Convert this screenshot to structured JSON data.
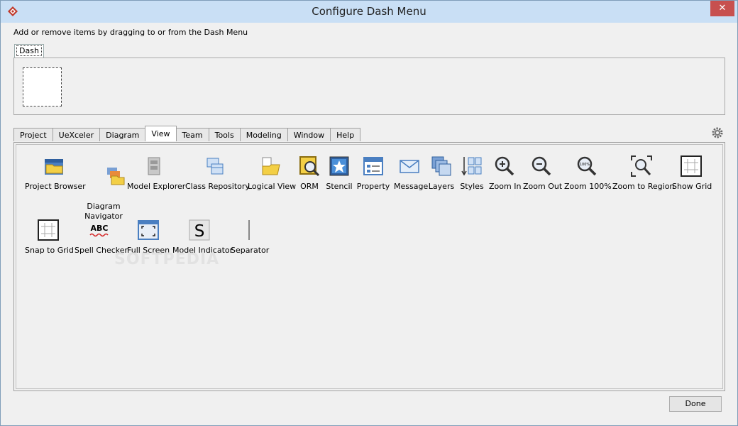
{
  "window": {
    "title": "Configure Dash Menu"
  },
  "instruction": "Add or remove items by dragging to or from the Dash Menu",
  "dash": {
    "tab_label": "Dash"
  },
  "tabs": [
    {
      "label": "Project"
    },
    {
      "label": "UeXceler"
    },
    {
      "label": "Diagram"
    },
    {
      "label": "View"
    },
    {
      "label": "Team"
    },
    {
      "label": "Tools"
    },
    {
      "label": "Modeling"
    },
    {
      "label": "Window"
    },
    {
      "label": "Help"
    }
  ],
  "active_tab": "View",
  "items": [
    {
      "label": "Project Browser",
      "icon": "project-browser-icon"
    },
    {
      "label": "Diagram\nNavigator",
      "icon": "diagram-navigator-icon"
    },
    {
      "label": "Model Explorer",
      "icon": "model-explorer-icon"
    },
    {
      "label": "Class Repository",
      "icon": "class-repository-icon"
    },
    {
      "label": "Logical View",
      "icon": "logical-view-icon"
    },
    {
      "label": "ORM",
      "icon": "orm-icon"
    },
    {
      "label": "Stencil",
      "icon": "stencil-icon"
    },
    {
      "label": "Property",
      "icon": "property-icon"
    },
    {
      "label": "Message",
      "icon": "message-icon"
    },
    {
      "label": "Layers",
      "icon": "layers-icon"
    },
    {
      "label": "Styles",
      "icon": "styles-icon"
    },
    {
      "label": "Zoom In",
      "icon": "zoom-in-icon"
    },
    {
      "label": "Zoom Out",
      "icon": "zoom-out-icon"
    },
    {
      "label": "Zoom 100%",
      "icon": "zoom-100-icon"
    },
    {
      "label": "Zoom to Region",
      "icon": "zoom-region-icon"
    },
    {
      "label": "Show Grid",
      "icon": "show-grid-icon"
    },
    {
      "label": "Snap to Grid",
      "icon": "snap-grid-icon"
    },
    {
      "label": "Spell Checker",
      "icon": "spell-checker-icon"
    },
    {
      "label": "Full Screen",
      "icon": "full-screen-icon"
    },
    {
      "label": "Model Indicator",
      "icon": "model-indicator-icon"
    },
    {
      "label": "Separator",
      "icon": "separator-icon"
    }
  ],
  "icon_text": {
    "spell": "ABC",
    "zoom100": "100%",
    "indicator": "S"
  },
  "watermark": "SOFTPEDIA",
  "footer": {
    "done_label": "Done"
  },
  "colors": {
    "titlebar": "#c9dff5",
    "close": "#c7504f",
    "accent_blue": "#4a7fc1",
    "folder_yellow": "#f3cf45"
  }
}
